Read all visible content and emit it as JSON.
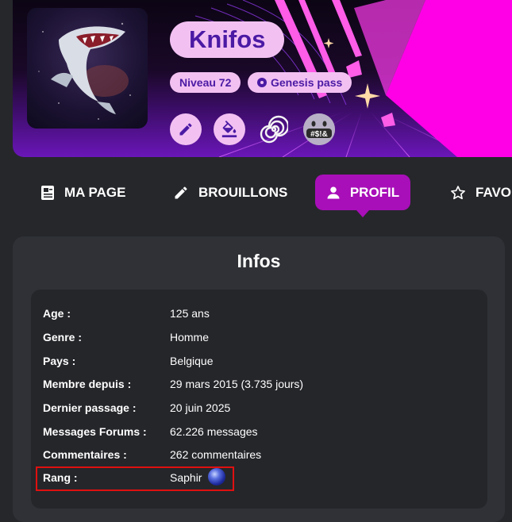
{
  "profile": {
    "username": "Knifos",
    "level_label": "Niveau 72",
    "pass_label": "Genesis pass",
    "cash_text": "#$!&"
  },
  "tabs": [
    {
      "label": "MA PAGE",
      "icon": "page-icon",
      "active": false
    },
    {
      "label": "BROUILLONS",
      "icon": "pencil-icon",
      "active": false
    },
    {
      "label": "PROFIL",
      "icon": "user-icon",
      "active": true
    },
    {
      "label": "FAVORIS",
      "icon": "star-icon",
      "active": false
    }
  ],
  "info": {
    "title": "Infos",
    "rows": [
      {
        "key": "Age :",
        "value": "125 ans"
      },
      {
        "key": "Genre :",
        "value": "Homme"
      },
      {
        "key": "Pays :",
        "value": "Belgique"
      },
      {
        "key": "Membre depuis :",
        "value": "29 mars 2015 (3.735 jours)"
      },
      {
        "key": "Dernier passage :",
        "value": "20 juin 2025"
      },
      {
        "key": "Messages Forums :",
        "value": "62.226 messages"
      },
      {
        "key": "Commentaires :",
        "value": "262 commentaires"
      },
      {
        "key": "Rang :",
        "value": "Saphir"
      }
    ]
  },
  "colors": {
    "accent": "#a80fb8",
    "pill_bg": "#f2c1f2",
    "pill_text": "#4b1aa4",
    "highlight": "#e01010"
  }
}
